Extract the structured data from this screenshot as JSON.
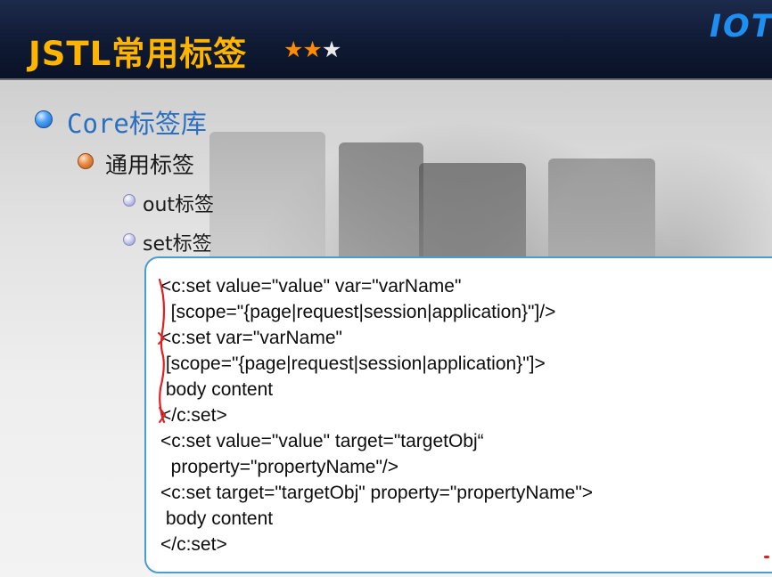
{
  "slide": {
    "title": "JSTL常用标签",
    "stars": {
      "filled": 2,
      "total": 3
    },
    "logo_text": "IOT",
    "accent_color": "#ffb400",
    "star_color": "#ff8a00",
    "link_color": "#2a6fc1"
  },
  "outline": {
    "level1": "Core标签库",
    "level2": "通用标签",
    "level3": [
      "out标签",
      "set标签"
    ]
  },
  "code": {
    "lines": [
      "<c:set value=\"value\" var=\"varName\"",
      "  [scope=\"{page|request|session|application}\"]/>",
      "<c:set var=\"varName\"",
      " [scope=\"{page|request|session|application}\"]>",
      " body content",
      "</c:set>",
      "<c:set value=\"value\" target=\"targetObj“",
      "  property=\"propertyName\"/>",
      "<c:set target=\"targetObj\" property=\"propertyName\">",
      " body content",
      "</c:set>"
    ],
    "border_color": "#4a9dd0",
    "annotation_color": "#e02020"
  }
}
